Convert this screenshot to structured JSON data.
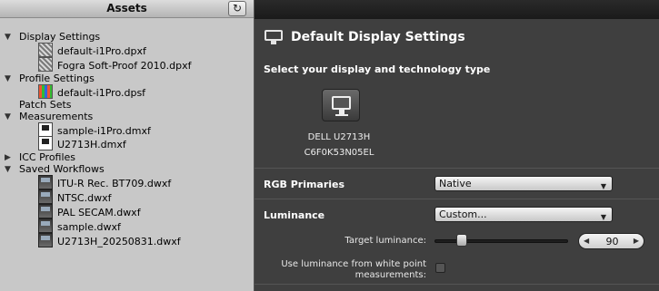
{
  "assets": {
    "title": "Assets",
    "refresh_icon": "↻",
    "groups": {
      "display_settings": {
        "label": "Display Settings",
        "items": [
          "default-i1Pro.dpxf",
          "Fogra Soft-Proof 2010.dpxf"
        ]
      },
      "profile_settings": {
        "label": "Profile Settings",
        "items": [
          "default-i1Pro.dpsf"
        ]
      },
      "patch_sets": {
        "label": "Patch Sets"
      },
      "measurements": {
        "label": "Measurements",
        "items": [
          "sample-i1Pro.dmxf",
          "U2713H.dmxf"
        ]
      },
      "icc_profiles": {
        "label": "ICC Profiles"
      },
      "saved_workflows": {
        "label": "Saved Workflows",
        "items": [
          "ITU-R Rec. BT709.dwxf",
          "NTSC.dwxf",
          "PAL SECAM.dwxf",
          "sample.dwxf",
          "U2713H_20250831.dwxf"
        ]
      }
    },
    "toggle_expanded": "▼",
    "toggle_collapsed": "▶"
  },
  "settings": {
    "title": "Default Display Settings",
    "subtitle": "Select your display and technology type",
    "display": {
      "name": "DELL U2713H",
      "serial": "C6F0K53N05EL"
    },
    "rgb_primaries": {
      "label": "RGB Primaries",
      "value": "Native"
    },
    "luminance": {
      "label": "Luminance",
      "value": "Custom..."
    },
    "target_luminance": {
      "label": "Target luminance:",
      "value": "90",
      "slider_fraction": 0.18
    },
    "use_white_point": {
      "label_line1": "Use luminance from white point",
      "label_line2": "measurements:",
      "checked": false
    },
    "select_arrow": "▼",
    "spin_left": "◀",
    "spin_right": "▶"
  }
}
